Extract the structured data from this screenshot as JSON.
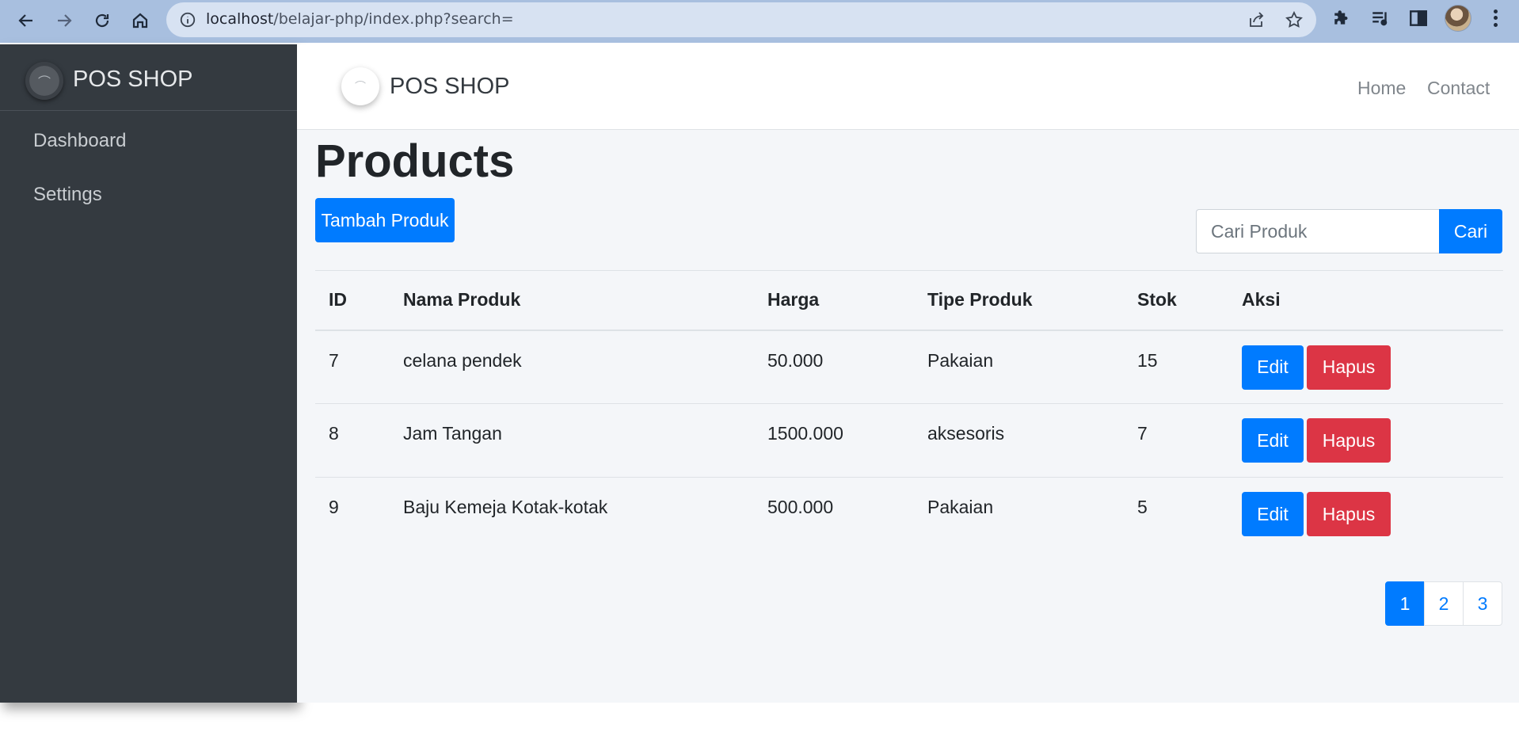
{
  "browser": {
    "url_host": "localhost",
    "url_path": "/belajar-php/index.php?search="
  },
  "sidebar": {
    "brand": "POS SHOP",
    "items": [
      {
        "label": "Dashboard"
      },
      {
        "label": "Settings"
      }
    ]
  },
  "topnav": {
    "brand": "POS SHOP",
    "links": [
      {
        "label": "Home"
      },
      {
        "label": "Contact"
      }
    ]
  },
  "main": {
    "title": "Products",
    "add_button": "Tambah Produk",
    "search": {
      "placeholder": "Cari Produk",
      "value": "",
      "button": "Cari"
    },
    "table": {
      "headers": [
        "ID",
        "Nama Produk",
        "Harga",
        "Tipe Produk",
        "Stok",
        "Aksi"
      ],
      "rows": [
        {
          "id": "7",
          "name": "celana pendek",
          "price": "50.000",
          "type": "Pakaian",
          "stock": "15"
        },
        {
          "id": "8",
          "name": "Jam Tangan",
          "price": "1500.000",
          "type": "aksesoris",
          "stock": "7"
        },
        {
          "id": "9",
          "name": "Baju Kemeja Kotak-kotak",
          "price": "500.000",
          "type": "Pakaian",
          "stock": "5"
        }
      ],
      "edit_label": "Edit",
      "delete_label": "Hapus"
    },
    "pagination": {
      "pages": [
        "1",
        "2",
        "3"
      ],
      "active": "1"
    }
  },
  "colors": {
    "primary": "#007bff",
    "danger": "#dc3545",
    "sidebar": "#343a40",
    "browser_bar": "#a8bfdf"
  }
}
